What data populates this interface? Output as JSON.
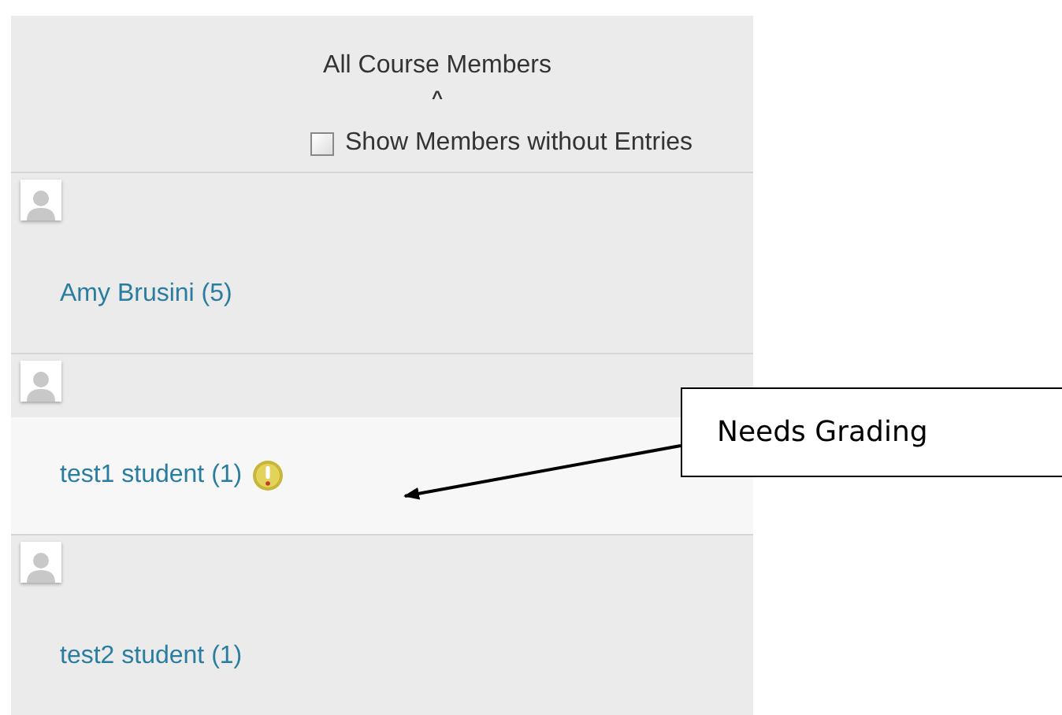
{
  "header": {
    "title": "All Course Members",
    "collapse_glyph": "^",
    "show_without_entries": {
      "label": "Show Members without Entries",
      "checked": false
    }
  },
  "members": [
    {
      "name": "Amy Brusini (5)",
      "needs_grading": false,
      "selected": false
    },
    {
      "name": "test1 student (1)",
      "needs_grading": true,
      "selected": true
    },
    {
      "name": "test2 student (1)",
      "needs_grading": false,
      "selected": false
    }
  ],
  "callout": {
    "text": "Needs Grading"
  }
}
